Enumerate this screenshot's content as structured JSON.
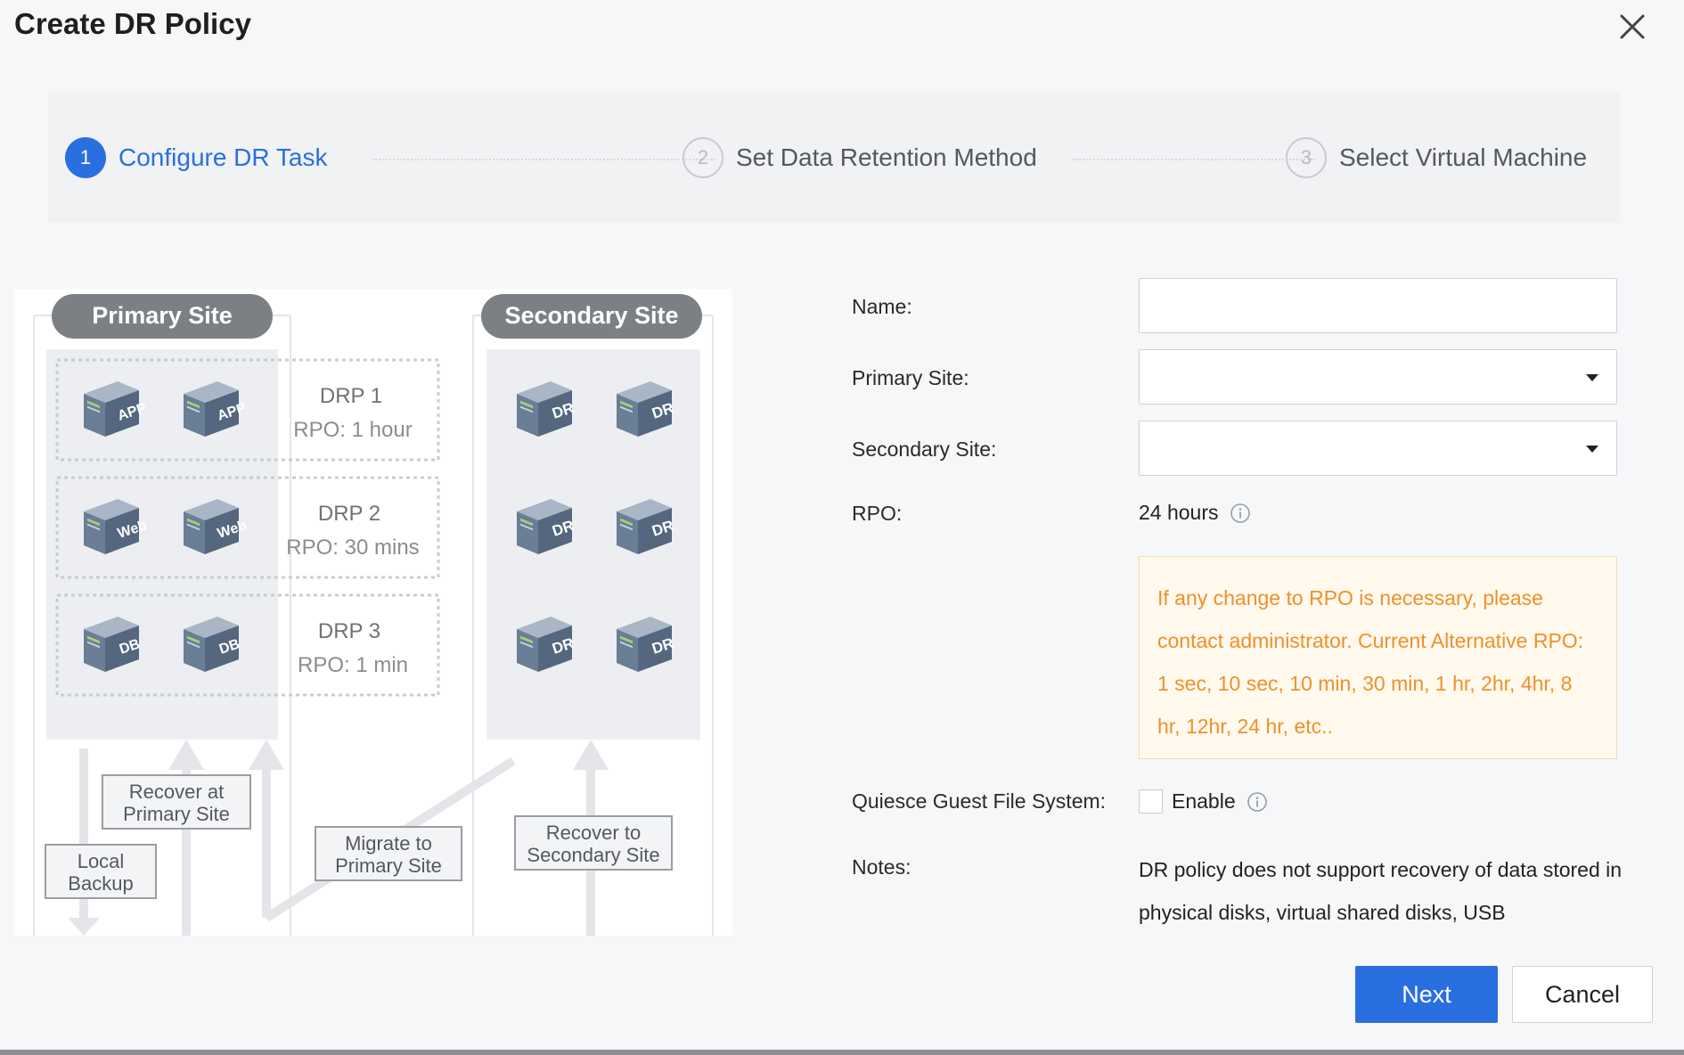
{
  "dialog": {
    "title": "Create DR Policy",
    "close_icon": "close-icon"
  },
  "steps": [
    {
      "number": "1",
      "label": "Configure DR Task",
      "state": "active"
    },
    {
      "number": "2",
      "label": "Set Data Retention Method",
      "state": "inactive"
    },
    {
      "number": "3",
      "label": "Select Virtual Machine",
      "state": "inactive"
    }
  ],
  "diagram": {
    "primary_site": "Primary Site",
    "secondary_site": "Secondary Site",
    "drp": [
      {
        "name": "DRP 1",
        "rpo": "RPO: 1 hour",
        "server_label": "APP"
      },
      {
        "name": "DRP 2",
        "rpo": "RPO: 30 mins",
        "server_label": "Web"
      },
      {
        "name": "DRP 3",
        "rpo": "RPO: 1 min",
        "server_label": "DB"
      }
    ],
    "dr_server_label": "DR",
    "recover_primary": [
      "Recover at",
      "Primary Site"
    ],
    "local_backup": [
      "Local",
      "Backup"
    ],
    "migrate_primary": [
      "Migrate to",
      "Primary Site"
    ],
    "recover_secondary": [
      "Recover to",
      "Secondary Site"
    ]
  },
  "form": {
    "name_label": "Name:",
    "name_value": "",
    "primary_site_label": "Primary Site:",
    "primary_site_value": "",
    "secondary_site_label": "Secondary Site:",
    "secondary_site_value": "",
    "rpo_label": "RPO:",
    "rpo_value": "24 hours",
    "rpo_warning": "If any change to RPO is necessary, please contact administrator. Current Alternative RPO: 1 sec, 10 sec, 10 min, 30 min, 1 hr, 2hr, 4hr, 8 hr, 12hr, 24 hr, etc..",
    "quiesce_label": "Quiesce Guest File System:",
    "quiesce_option": "Enable",
    "quiesce_checked": false,
    "notes_label": "Notes:",
    "notes_text": "DR policy does not support recovery of data stored in physical disks, virtual shared disks, USB"
  },
  "buttons": {
    "next": "Next",
    "cancel": "Cancel"
  },
  "colors": {
    "accent": "#2a6fe0",
    "warning_text": "#f0902a",
    "warning_bg": "#fff9ee"
  }
}
